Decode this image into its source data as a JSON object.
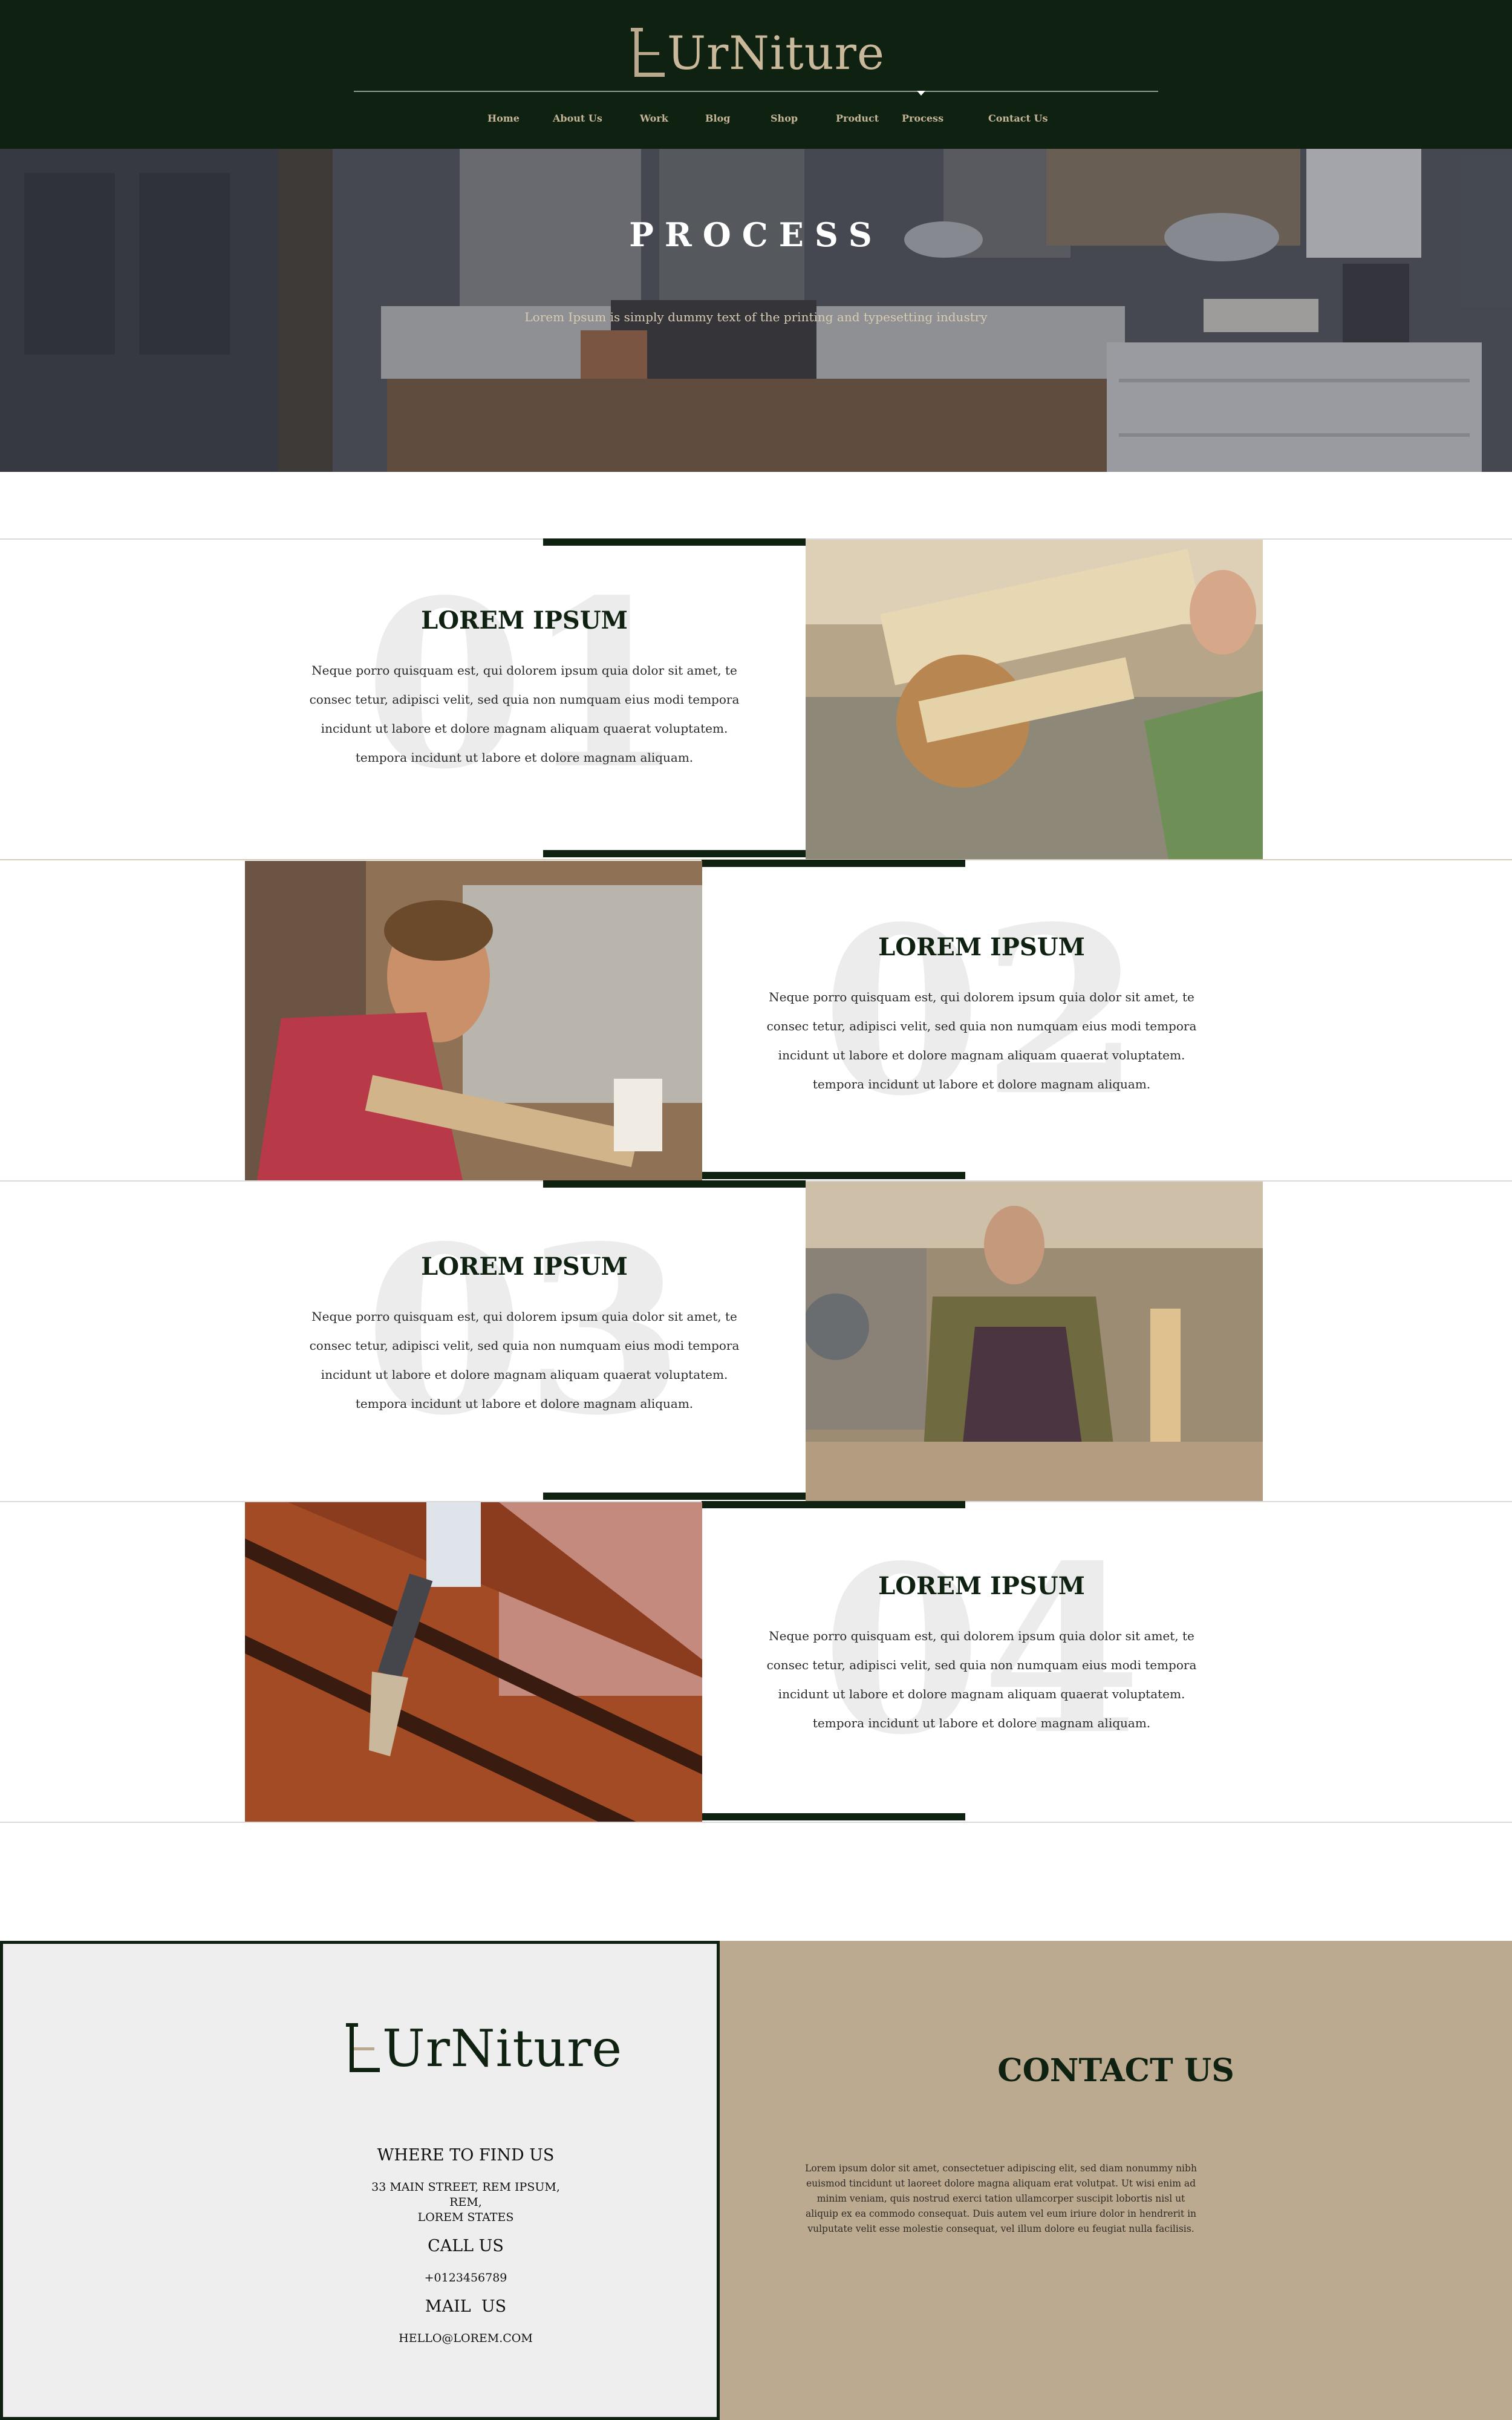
{
  "brand": {
    "name": "UrNiture"
  },
  "nav": {
    "items": [
      {
        "label": "Home"
      },
      {
        "label": "About Us"
      },
      {
        "label": "Work"
      },
      {
        "label": "Blog"
      },
      {
        "label": "Shop"
      },
      {
        "label": "Product"
      },
      {
        "label": "Process"
      },
      {
        "label": "Contact Us"
      }
    ],
    "active": "Process"
  },
  "hero": {
    "title": "PROCESS",
    "subtitle": "Lorem Ipsum is simply dummy text of the printing and typesetting industry"
  },
  "steps": [
    {
      "number": "01",
      "title": "LOREM IPSUM",
      "body": "Neque porro quisquam est, qui dolorem ipsum quia dolor sit amet, te consec tetur, adipisci velit, sed quia non numquam eius modi tempora incidunt ut labore et dolore magnam aliquam quaerat voluptatem. tempora incidunt ut labore et dolore magnam aliquam.",
      "photo": "table saw cutting wood plank"
    },
    {
      "number": "02",
      "title": "LOREM IPSUM",
      "body": "Neque porro quisquam est, qui dolorem ipsum quia dolor sit amet, te consec tetur, adipisci velit, sed quia non numquam eius modi tempora incidunt ut labore et dolore magnam aliquam quaerat voluptatem. tempora incidunt ut labore et dolore magnam aliquam.",
      "photo": "carpenter planing wood"
    },
    {
      "number": "03",
      "title": "LOREM IPSUM",
      "body": "Neque porro quisquam est, qui dolorem ipsum quia dolor sit amet, te consec tetur, adipisci velit, sed quia non numquam eius modi tempora incidunt ut labore et dolore magnam aliquam quaerat voluptatem. tempora incidunt ut labore et dolore magnam aliquam.",
      "photo": "craftsman holding turned wood piece"
    },
    {
      "number": "04",
      "title": "LOREM IPSUM",
      "body": "Neque porro quisquam est, qui dolorem ipsum quia dolor sit amet, te consec tetur, adipisci velit, sed quia non numquam eius modi tempora incidunt ut labore et dolore magnam aliquam quaerat voluptatem. tempora incidunt ut labore et dolore magnam aliquam.",
      "photo": "brush varnishing wooden boards"
    }
  ],
  "footer": {
    "find_us_heading": "WHERE TO FIND US",
    "address_line1": "33 MAIN STREET, REM IPSUM,",
    "address_line2": "REM,",
    "address_line3": "LOREM STATES",
    "call_heading": "CALL US",
    "phone": "+0123456789",
    "mail_heading": "MAIL  US",
    "email": "HELLO@LOREM.COM",
    "contact_title": "CONTACT US",
    "contact_body": "Lorem ipsum dolor sit amet, consectetuer adipiscing elit, sed diam nonummy nibh euismod tincidunt ut laoreet dolore magna aliquam erat volutpat. Ut wisi enim ad minim veniam, quis nostrud exerci tation ullamcorper suscipit lobortis nisl ut aliquip ex ea commodo consequat. Duis autem vel eum iriure dolor in hendrerit in vulputate velit esse molestie consequat, vel illum dolore eu feugiat nulla facilisis."
  },
  "colors": {
    "dark_green": "#0f2212",
    "tan": "#bba990",
    "gold_text": "#c9b899"
  }
}
